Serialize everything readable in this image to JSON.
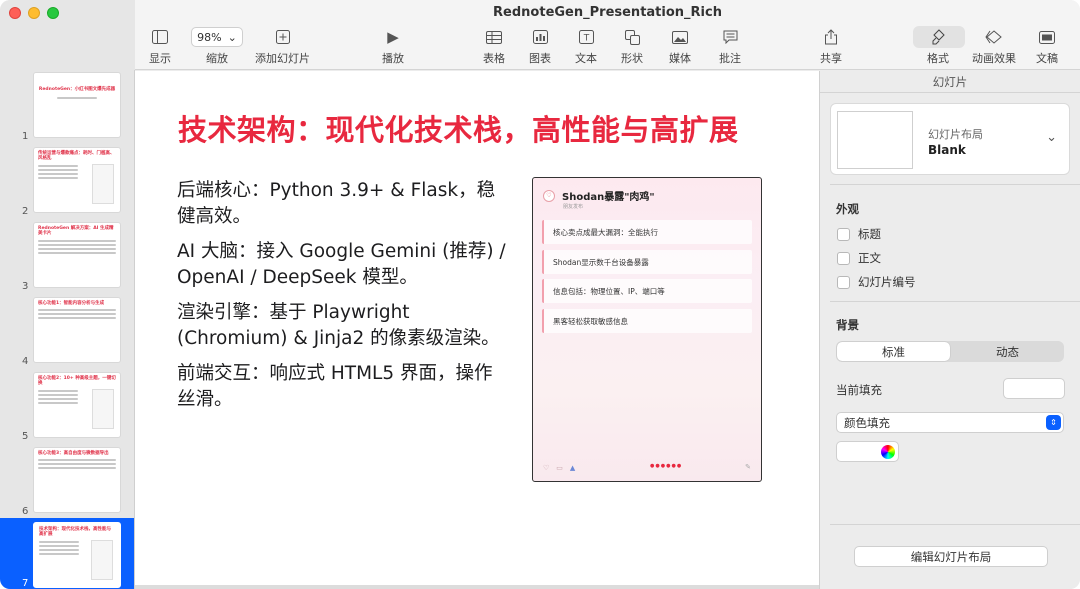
{
  "window": {
    "title": "RednoteGen_Presentation_Rich"
  },
  "toolbar": {
    "display": "显示",
    "zoom_value": "98%",
    "zoom": "缩放",
    "add_slide": "添加幻灯片",
    "play": "播放",
    "table": "表格",
    "chart": "图表",
    "text": "文本",
    "shape": "形状",
    "media": "媒体",
    "comment": "批注",
    "share": "共享",
    "format": "格式",
    "animate": "动画效果",
    "document": "文稿"
  },
  "thumbnails": [
    {
      "num": "1",
      "title": "RednoteGen：小红书图文爆先成器"
    },
    {
      "num": "2",
      "title": "传统运营与爆款痛点：耗时、门槛高、风格乱"
    },
    {
      "num": "3",
      "title": "RednoteGen 解决方案：AI 生成精美卡片"
    },
    {
      "num": "4",
      "title": "核心功能1：智能内容分析与生成"
    },
    {
      "num": "5",
      "title": "核心功能2：10+ 种高级主题，一键切换"
    },
    {
      "num": "6",
      "title": "核心功能3：高自由度与微数据导出"
    },
    {
      "num": "7",
      "title": "技术架构：现代化技术栈，高性能与高扩展"
    }
  ],
  "slide": {
    "title": "技术架构：现代化技术栈，高性能与高扩展",
    "bullets": [
      "后端核心：Python 3.9+ & Flask，稳健高效。",
      "AI 大脑：接入 Google Gemini (推荐) / OpenAI / DeepSeek 模型。",
      "渲染引擎：基于 Playwright (Chromium) & Jinja2 的像素级渲染。",
      "前端交互：响应式 HTML5 界面，操作丝滑。"
    ],
    "phone": {
      "title": "Shodan暴露\"肉鸡\"",
      "subtitle": "朋友发布",
      "cards": [
        "核心卖点成最大漏洞：全能执行",
        "Shodan显示数千台设备暴露",
        "信息包括：物理位置、IP、端口等",
        "黑客轻松获取敏感信息"
      ]
    }
  },
  "inspector": {
    "header": "幻灯片",
    "layout_label": "幻灯片布局",
    "layout_name": "Blank",
    "appearance": "外观",
    "checks": [
      "标题",
      "正文",
      "幻灯片编号"
    ],
    "background": "背景",
    "seg_standard": "标准",
    "seg_dynamic": "动态",
    "current_fill": "当前填充",
    "fill_type": "颜色填充",
    "edit_layout": "编辑幻灯片布局"
  },
  "colors": {
    "title_red": "#e8283f",
    "selection_blue": "#0a60ff"
  }
}
